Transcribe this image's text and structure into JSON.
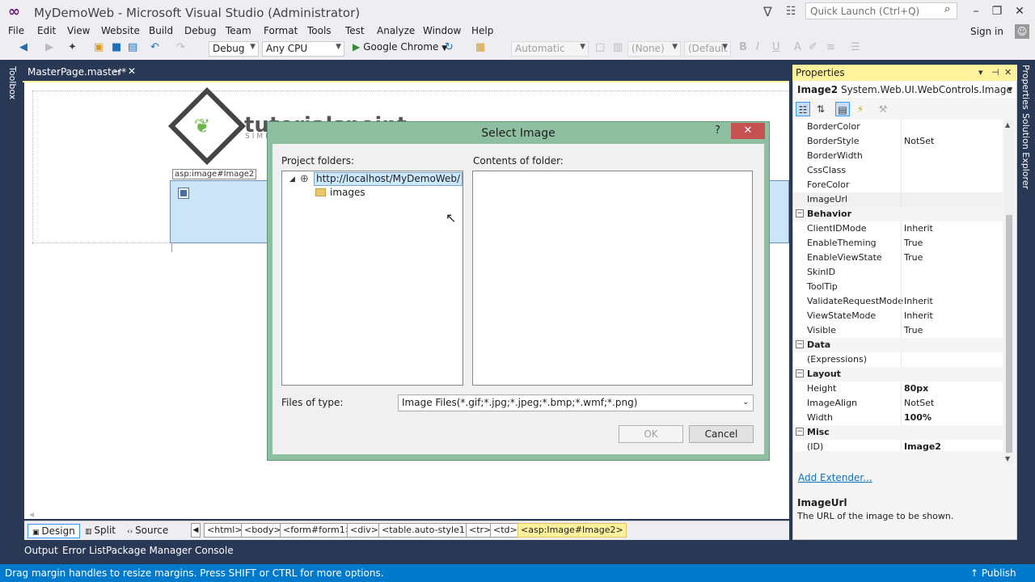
{
  "window": {
    "title": "MyDemoWeb - Microsoft Visual Studio (Administrator)",
    "quick_launch_placeholder": "Quick Launch (Ctrl+Q)"
  },
  "menu": [
    "File",
    "Edit",
    "View",
    "Website",
    "Build",
    "Debug",
    "Team",
    "Format",
    "Tools",
    "Test",
    "Analyze",
    "Window",
    "Help"
  ],
  "account": {
    "sign_in": "Sign in"
  },
  "toolbar": {
    "config": "Debug",
    "platform": "Any CPU",
    "run_target": "Google Chrome",
    "style_target": "Automatic",
    "font_name": "(None)",
    "font_size": "(Default"
  },
  "toolbox_label": "Toolbox",
  "editor": {
    "tab_label": "MasterPage.master*",
    "logo_text": "tutorialspoint",
    "logo_sub": "SIMPLY EASY LEARNING",
    "image_tag": "asp:image#Image2"
  },
  "view_modes": [
    "Design",
    "Split",
    "Source"
  ],
  "breadcrumbs": [
    "<html>",
    "<body>",
    "<form#form1>",
    "<div>",
    "<table.auto-style1>",
    "<tr>",
    "<td>",
    "<asp:Image#Image2>"
  ],
  "bottom_tabs": [
    "Output",
    "Error List",
    "Package Manager Console"
  ],
  "status": {
    "text": "Drag margin handles to resize margins. Press SHIFT or CTRL for more options.",
    "publish": "Publish"
  },
  "properties": {
    "title": "Properties",
    "object_name": "Image2",
    "object_type": "System.Web.UI.WebControls.Image",
    "rows": [
      {
        "name": "BorderColor",
        "value": ""
      },
      {
        "name": "BorderStyle",
        "value": "NotSet"
      },
      {
        "name": "BorderWidth",
        "value": ""
      },
      {
        "name": "CssClass",
        "value": ""
      },
      {
        "name": "ForeColor",
        "value": ""
      },
      {
        "name": "ImageUrl",
        "value": ""
      },
      {
        "name": "Behavior",
        "value": ""
      },
      {
        "name": "ClientIDMode",
        "value": "Inherit"
      },
      {
        "name": "EnableTheming",
        "value": "True"
      },
      {
        "name": "EnableViewState",
        "value": "True"
      },
      {
        "name": "SkinID",
        "value": ""
      },
      {
        "name": "ToolTip",
        "value": ""
      },
      {
        "name": "ValidateRequestMode",
        "value": "Inherit"
      },
      {
        "name": "ViewStateMode",
        "value": "Inherit"
      },
      {
        "name": "Visible",
        "value": "True"
      },
      {
        "name": "Data",
        "value": ""
      },
      {
        "name": "(Expressions)",
        "value": ""
      },
      {
        "name": "Layout",
        "value": ""
      },
      {
        "name": "Height",
        "value": "80px"
      },
      {
        "name": "ImageAlign",
        "value": "NotSet"
      },
      {
        "name": "Width",
        "value": "100%"
      },
      {
        "name": "Misc",
        "value": ""
      },
      {
        "name": "(ID)",
        "value": "Image2"
      }
    ],
    "add_extender": "Add Extender...",
    "desc_name": "ImageUrl",
    "desc_text": "The URL of the image to be shown."
  },
  "right_strip": [
    "Properties",
    "Solution Explorer"
  ],
  "dialog": {
    "title": "Select Image",
    "project_folders_label": "Project folders:",
    "contents_label": "Contents of folder:",
    "tree_root": "http://localhost/MyDemoWeb/",
    "tree_child": "images",
    "files_of_type_label": "Files of type:",
    "files_of_type_value": "Image Files(*.gif;*.jpg;*.jpeg;*.bmp;*.wmf;*.png)",
    "ok": "OK",
    "cancel": "Cancel"
  }
}
